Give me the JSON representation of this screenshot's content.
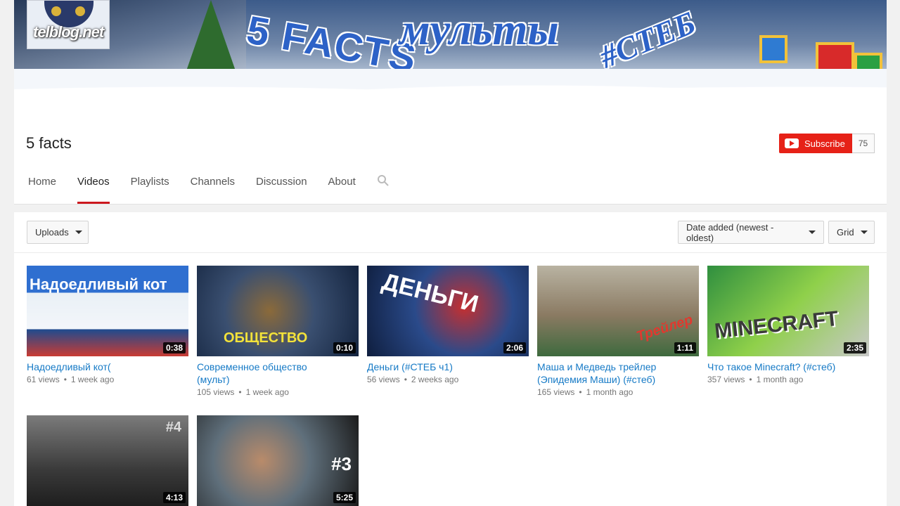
{
  "banner": {
    "logo_text": "telblog.net",
    "words": [
      "5 FACTS",
      "мульты",
      "#СТЕБ"
    ]
  },
  "channel": {
    "name": "5 facts",
    "subscribe_label": "Subscribe",
    "subscriber_count": "75"
  },
  "tabs": [
    {
      "label": "Home"
    },
    {
      "label": "Videos"
    },
    {
      "label": "Playlists"
    },
    {
      "label": "Channels"
    },
    {
      "label": "Discussion"
    },
    {
      "label": "About"
    }
  ],
  "toolbar": {
    "uploads_label": "Uploads",
    "sort_label": "Date added (newest - oldest)",
    "view_label": "Grid"
  },
  "videos": [
    {
      "title": "Надоедливый кот(",
      "title_line2": "",
      "views": "61 views",
      "age": "1 week ago",
      "duration": "0:38",
      "thumb_text": "Надоедливый кот"
    },
    {
      "title": "Современное общество",
      "title_line2": "(мульт)",
      "views": "105 views",
      "age": "1 week ago",
      "duration": "0:10",
      "thumb_text": "ОБЩЕСТВО"
    },
    {
      "title": "Деньги (#СТЕБ ч1)",
      "title_line2": "",
      "views": "56 views",
      "age": "2 weeks ago",
      "duration": "2:06",
      "thumb_text": "ДЕНЬГИ"
    },
    {
      "title": "Маша и Медведь трейлер",
      "title_line2": "(Эпидемия Маши) (#стеб)",
      "views": "165 views",
      "age": "1 month ago",
      "duration": "1:11",
      "thumb_text": "Трейлер"
    },
    {
      "title": "Что такое Minecraft? (#стеб)",
      "title_line2": "",
      "views": "357 views",
      "age": "1 month ago",
      "duration": "2:35",
      "thumb_text": "MINECRAFT"
    },
    {
      "title": "",
      "title_line2": "",
      "views": "",
      "age": "",
      "duration": "4:13",
      "thumb_text": "#4"
    },
    {
      "title": "",
      "title_line2": "",
      "views": "",
      "age": "",
      "duration": "5:25",
      "thumb_text": "#3"
    }
  ],
  "colors": {
    "accent": "#e62117",
    "link": "#167ac6",
    "tab_underline": "#cc181e"
  }
}
